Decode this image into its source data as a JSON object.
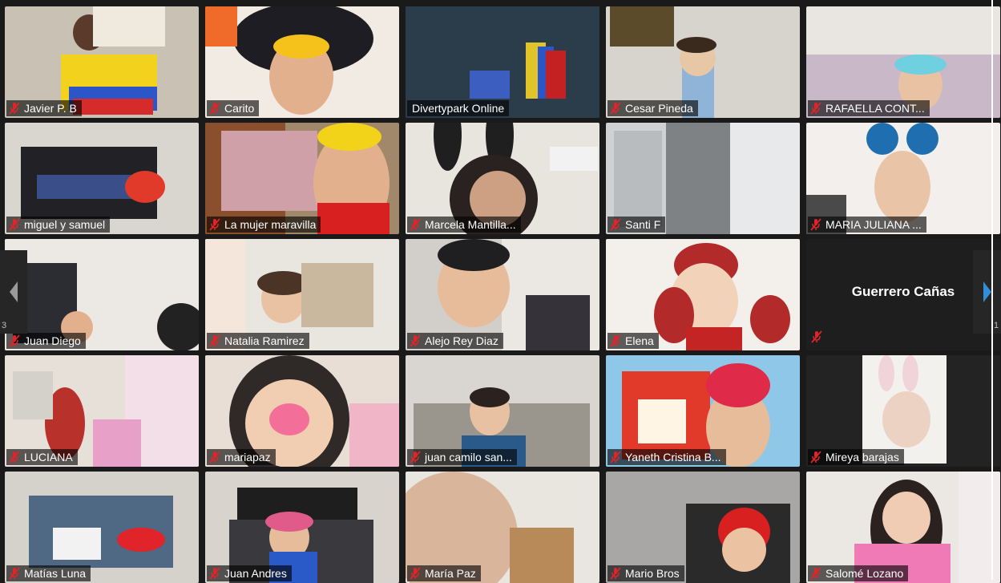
{
  "meeting": {
    "participants": [
      {
        "name": "Javier P. B",
        "muted": true
      },
      {
        "name": "Carito",
        "muted": true
      },
      {
        "name": "Divertypark Online",
        "muted": false,
        "active": true
      },
      {
        "name": "Cesar Pineda",
        "muted": true
      },
      {
        "name": "RAFAELLA CONT...",
        "muted": true
      },
      {
        "name": "miguel y samuel",
        "muted": true
      },
      {
        "name": "La mujer maravilla",
        "muted": true
      },
      {
        "name": "Marcela Mantilla...",
        "muted": true
      },
      {
        "name": "Santi F",
        "muted": true
      },
      {
        "name": "MARIA JULIANA ...",
        "muted": true
      },
      {
        "name": "Juan Diego",
        "muted": true
      },
      {
        "name": "Natalia Ramirez",
        "muted": true
      },
      {
        "name": "Alejo Rey Diaz",
        "muted": true
      },
      {
        "name": "Elena",
        "muted": true
      },
      {
        "name": "Guerrero Cañas",
        "muted": true,
        "video_off": true
      },
      {
        "name": "LUCIANA",
        "muted": true
      },
      {
        "name": "mariapaz",
        "muted": true
      },
      {
        "name": "juan camilo san...",
        "muted": true
      },
      {
        "name": "Yaneth Cristina B...",
        "muted": true
      },
      {
        "name": "Mireya barajas",
        "muted": true
      },
      {
        "name": "Matías Luna",
        "muted": true
      },
      {
        "name": "Juan Andres",
        "muted": true
      },
      {
        "name": "María Paz",
        "muted": true
      },
      {
        "name": "Mario Bros",
        "muted": true
      },
      {
        "name": "Salomé Lozano",
        "muted": true
      }
    ],
    "pagination": {
      "left_page": "3",
      "right_page": "1"
    },
    "icons": {
      "mic": "muted-mic-icon",
      "prev": "chevron-left-icon",
      "next": "chevron-right-icon"
    },
    "colors": {
      "active_border": "#c7e04a",
      "muted_icon": "#e0242a",
      "nav_arrow": "#2f8fd8"
    }
  }
}
